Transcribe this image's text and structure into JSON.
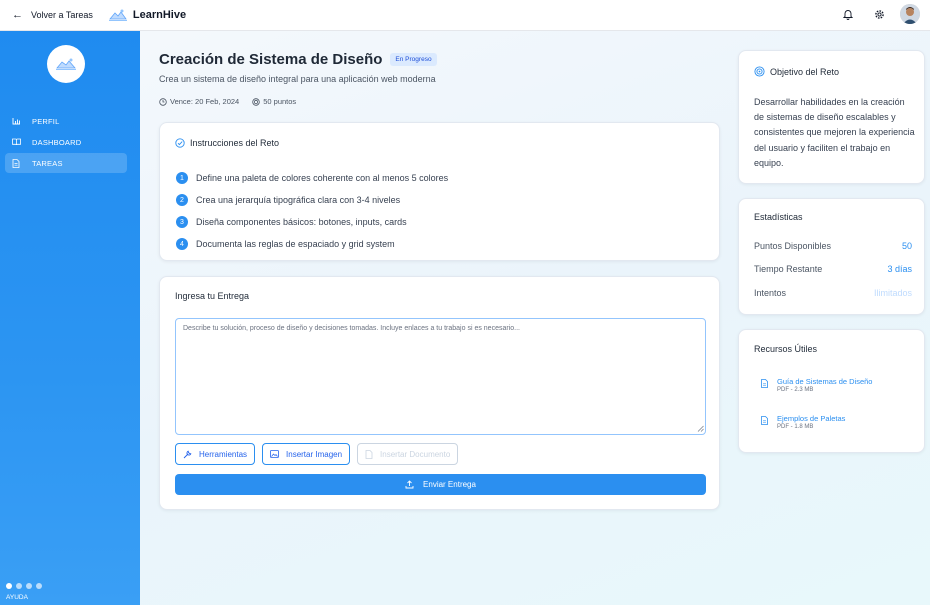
{
  "topbar": {
    "back_label": "Volver a Tareas",
    "brand": "LearnHive"
  },
  "sidebar": {
    "items": [
      {
        "label": "PERFIL",
        "icon": "bar-chart-icon",
        "active": false
      },
      {
        "label": "DASHBOARD",
        "icon": "book-icon",
        "active": false
      },
      {
        "label": "TAREAS",
        "icon": "document-icon",
        "active": true
      }
    ],
    "help_label": "AYUDA"
  },
  "challenge": {
    "title": "Creación de Sistema de Diseño",
    "status": "En Progreso",
    "subtitle": "Crea un sistema de diseño integral para una aplicación web moderna",
    "due": "Vence: 20 Feb, 2024",
    "points": "50 puntos"
  },
  "instructions": {
    "title": "Instrucciones del Reto",
    "steps": [
      {
        "num": "1",
        "text": "Define una paleta de colores coherente con al menos 5 colores"
      },
      {
        "num": "2",
        "text": "Crea una jerarquía tipográfica clara con 3-4 niveles"
      },
      {
        "num": "3",
        "text": "Diseña componentes básicos: botones, inputs, cards"
      },
      {
        "num": "4",
        "text": "Documenta las reglas de espaciado y grid system"
      }
    ]
  },
  "entry": {
    "title": "Ingresa tu Entrega",
    "placeholder": "Describe tu solución, proceso de diseño y decisiones tomadas. Incluye enlaces a tu trabajo si es necesario...",
    "tools_label": "Herramientas",
    "insert_image_label": "Insertar Imagen",
    "insert_doc_label": "Insertar Documento",
    "submit_label": "Enviar Entrega"
  },
  "objective": {
    "title": "Objetivo del Reto",
    "text": "Desarrollar habilidades en la creación de sistemas de diseño escalables y consistentes que mejoren la experiencia del usuario y faciliten el trabajo en equipo."
  },
  "stats": {
    "title": "Estadísticas",
    "rows": [
      {
        "label": "Puntos Disponibles",
        "value": "50"
      },
      {
        "label": "Tiempo Restante",
        "value": "3 días"
      },
      {
        "label": "Intentos",
        "value": "Ilimitados"
      }
    ]
  },
  "resources": {
    "title": "Recursos Útiles",
    "items": [
      {
        "name": "Guía de Sistemas de Diseño",
        "size": "PDF - 2.3 MB"
      },
      {
        "name": "Ejemplos de Paletas",
        "size": "PDF - 1.8 MB"
      }
    ]
  },
  "colors": {
    "primary": "#2b8ff0",
    "sidebar": "#1f8bf0",
    "badge_bg": "#dbeafe"
  }
}
